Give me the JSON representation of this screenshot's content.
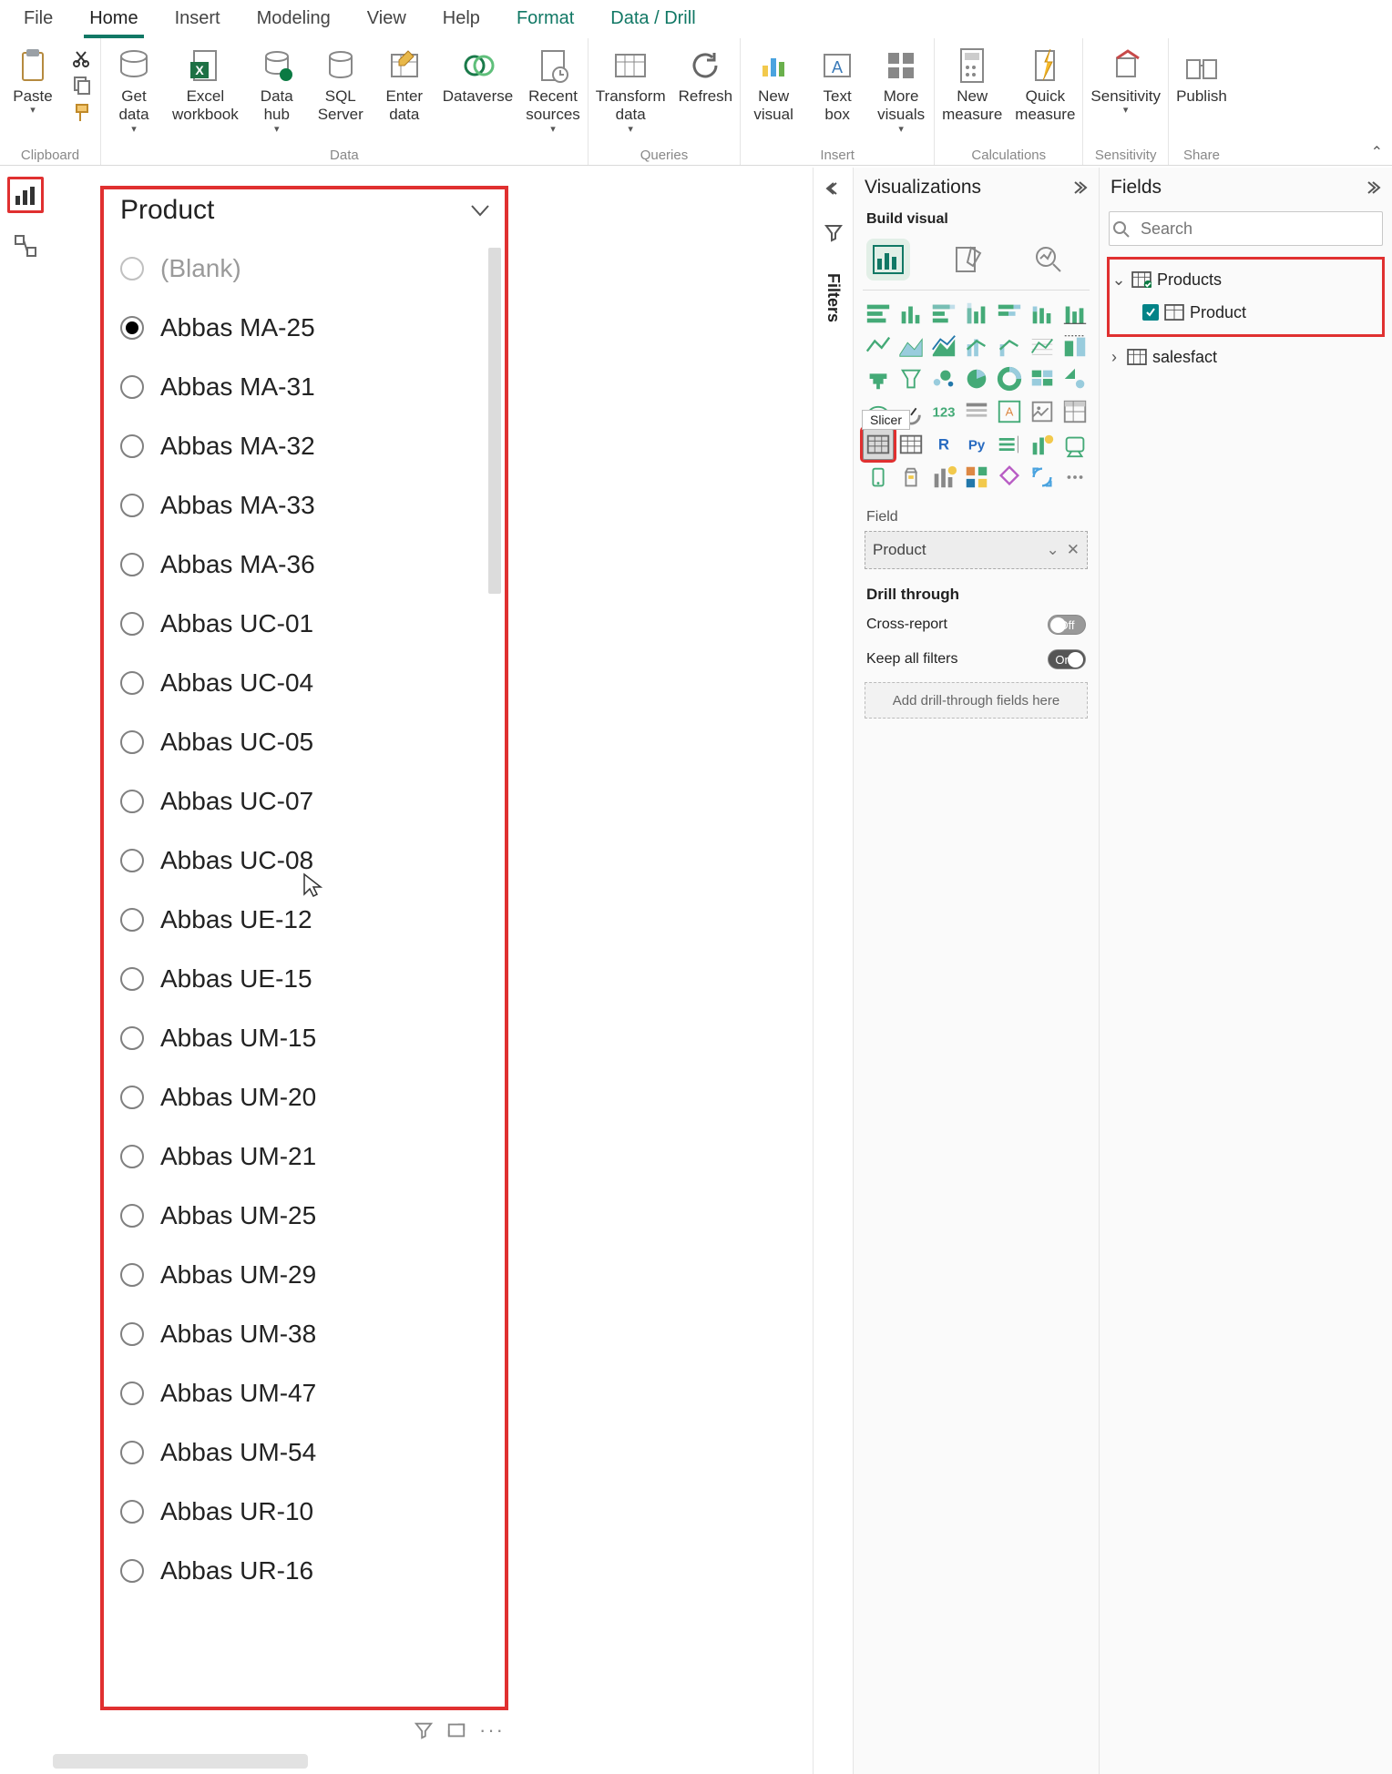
{
  "ribbon": {
    "tabs": [
      "File",
      "Home",
      "Insert",
      "Modeling",
      "View",
      "Help",
      "Format",
      "Data / Drill"
    ],
    "active_tab": "Home",
    "context_tabs": [
      "Format",
      "Data / Drill"
    ],
    "groups": {
      "clipboard": {
        "label": "Clipboard",
        "paste": "Paste"
      },
      "data": {
        "label": "Data",
        "get_data": "Get\ndata",
        "excel": "Excel\nworkbook",
        "hub": "Data\nhub",
        "sql": "SQL\nServer",
        "enter": "Enter\ndata",
        "dataverse": "Dataverse",
        "recent": "Recent\nsources"
      },
      "queries": {
        "label": "Queries",
        "transform": "Transform\ndata",
        "refresh": "Refresh"
      },
      "insert": {
        "label": "Insert",
        "visual": "New\nvisual",
        "textbox": "Text\nbox",
        "more": "More\nvisuals"
      },
      "calc": {
        "label": "Calculations",
        "measure": "New\nmeasure",
        "quick": "Quick\nmeasure"
      },
      "sensitivity": {
        "label": "Sensitivity",
        "btn": "Sensitivity"
      },
      "share": {
        "label": "Share",
        "publish": "Publish"
      }
    }
  },
  "slicer": {
    "title": "Product",
    "items": [
      {
        "label": "(Blank)",
        "selected": false,
        "dim": true
      },
      {
        "label": "Abbas MA-25",
        "selected": true
      },
      {
        "label": "Abbas MA-31"
      },
      {
        "label": "Abbas MA-32"
      },
      {
        "label": "Abbas MA-33"
      },
      {
        "label": "Abbas MA-36"
      },
      {
        "label": "Abbas UC-01"
      },
      {
        "label": "Abbas UC-04"
      },
      {
        "label": "Abbas UC-05"
      },
      {
        "label": "Abbas UC-07"
      },
      {
        "label": "Abbas UC-08"
      },
      {
        "label": "Abbas UE-12"
      },
      {
        "label": "Abbas UE-15"
      },
      {
        "label": "Abbas UM-15"
      },
      {
        "label": "Abbas UM-20"
      },
      {
        "label": "Abbas UM-21"
      },
      {
        "label": "Abbas UM-25"
      },
      {
        "label": "Abbas UM-29"
      },
      {
        "label": "Abbas UM-38"
      },
      {
        "label": "Abbas UM-47"
      },
      {
        "label": "Abbas UM-54"
      },
      {
        "label": "Abbas UR-10"
      },
      {
        "label": "Abbas UR-16"
      }
    ]
  },
  "filters_label": "Filters",
  "viz_panel": {
    "title": "Visualizations",
    "subtitle": "Build visual",
    "tooltip": "Slicer",
    "field_section": "Field",
    "field_value": "Product",
    "drill_title": "Drill through",
    "cross": "Cross-report",
    "cross_state": "Off",
    "keep": "Keep all filters",
    "keep_state": "On",
    "dropzone": "Add drill-through fields here"
  },
  "fields_panel": {
    "title": "Fields",
    "search_placeholder": "Search",
    "table1": "Products",
    "col1": "Product",
    "table2": "salesfact"
  }
}
